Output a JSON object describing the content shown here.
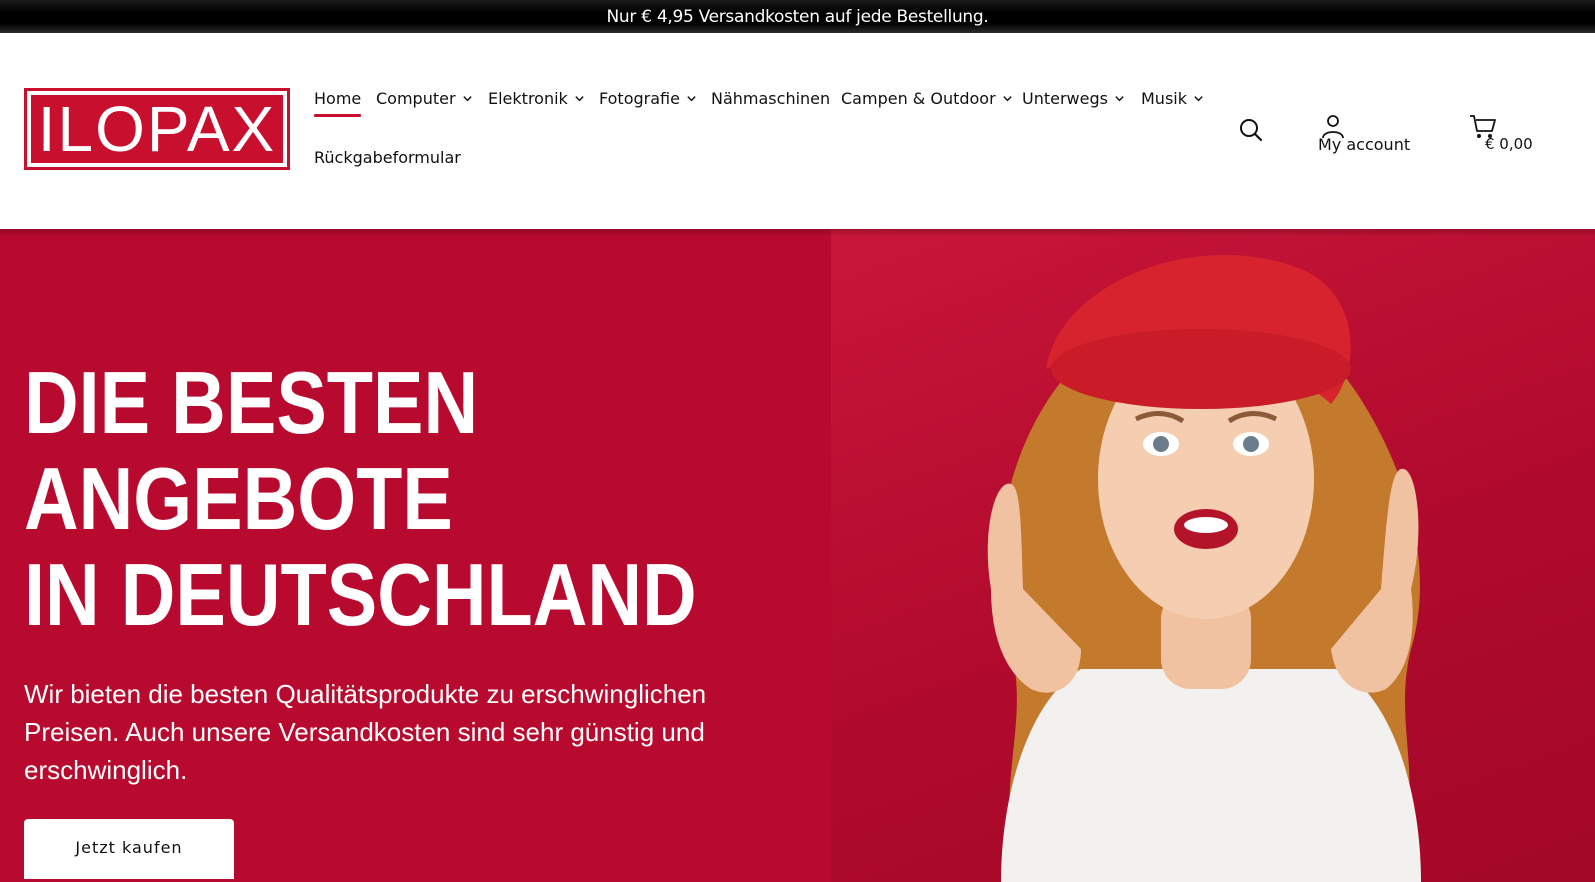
{
  "promo_bar": {
    "text": "Nur € 4,95 Versandkosten auf jede Bestellung."
  },
  "header": {
    "logo_text": "ILOPAX",
    "nav": [
      {
        "label": "Home",
        "active": true,
        "has_dropdown": false
      },
      {
        "label": "Computer",
        "has_dropdown": true
      },
      {
        "label": "Elektronik",
        "has_dropdown": true
      },
      {
        "label": "Fotografie",
        "has_dropdown": true
      },
      {
        "label": "Nähmaschinen",
        "has_dropdown": false
      },
      {
        "label": "Campen & Outdoor",
        "has_dropdown": true
      },
      {
        "label": "Unterwegs",
        "has_dropdown": true
      },
      {
        "label": "Musik",
        "has_dropdown": true
      },
      {
        "label": "Rückgabeformular",
        "has_dropdown": false
      }
    ],
    "icons": {
      "search": "search-icon",
      "account": "user-icon",
      "cart": "cart-icon"
    },
    "account_label": "My account",
    "cart_total": "€ 0,00"
  },
  "hero": {
    "title_lines": [
      "DIE BESTEN",
      "ANGEBOTE",
      "IN DEUTSCHLAND"
    ],
    "text": "Wir bieten die besten Qualitätsprodukte zu erschwinglichen Preisen. Auch unsere Versandkosten sind sehr günstig und erschwinglich.",
    "cta_label": "Jetzt kaufen"
  },
  "colors": {
    "brand_red": "#c8102e",
    "hero_background": "#b80a2e",
    "promo_background": "#000000"
  }
}
